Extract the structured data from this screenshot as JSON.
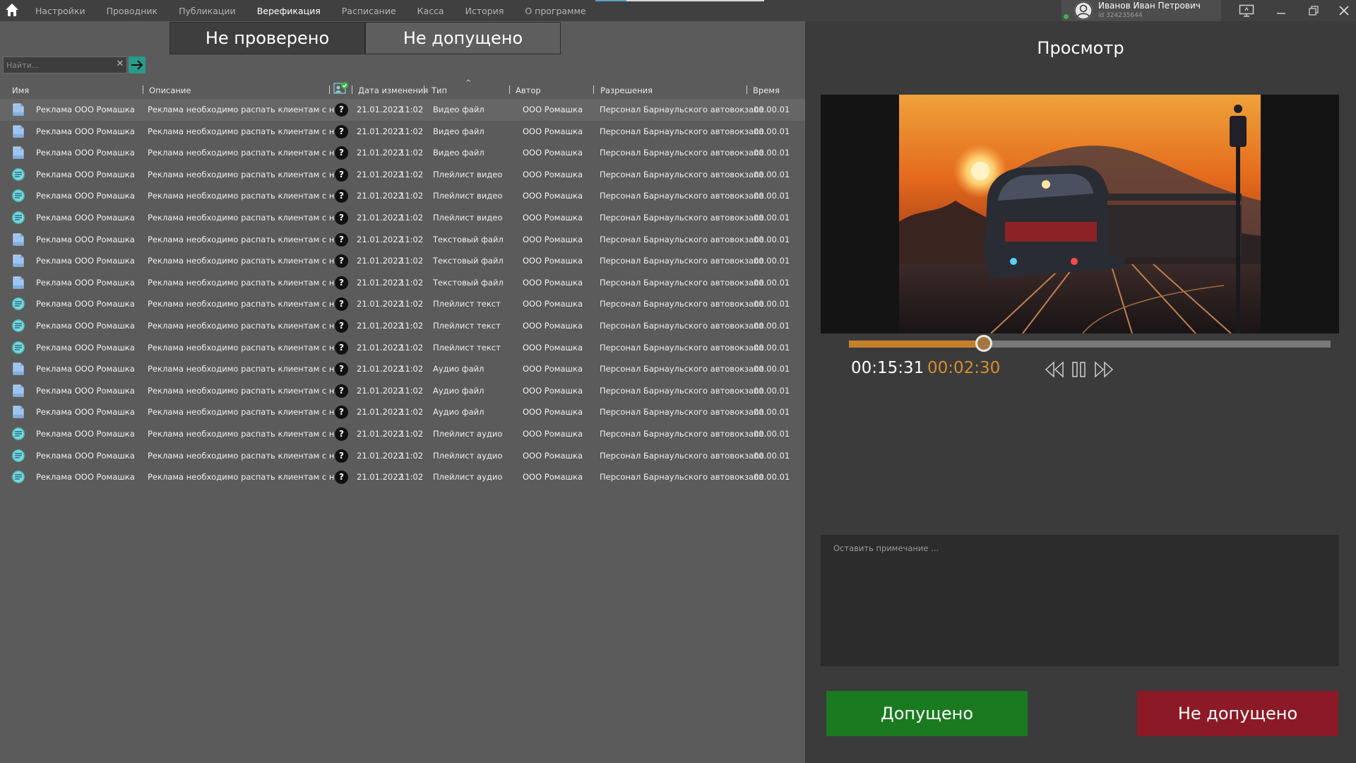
{
  "nav": {
    "items": [
      "Настройки",
      "Проводник",
      "Публикации",
      "Верефикация",
      "Расписание",
      "Касса",
      "История",
      "О программе"
    ],
    "active_index": 3
  },
  "user": {
    "name": "Иванов Иван Петрович",
    "id": "id 324235644",
    "status": "online"
  },
  "tabs": {
    "unverified": "Не проверено",
    "rejected": "Не допущено",
    "active": "unverified"
  },
  "search": {
    "placeholder": "Найти...",
    "clear_label": "✕"
  },
  "table": {
    "columns": {
      "name": "Имя",
      "description": "Описание",
      "date": "Дата изменения",
      "type": "Тип",
      "author": "Автор",
      "permissions": "Разрешения",
      "time": "Время"
    },
    "sort_indicator": "^",
    "rows": [
      {
        "icon": "file-icon",
        "name": "Реклама ООО Ромашка",
        "description": "Реклама необходимо распать клиентам с на...",
        "date": "21.01.2022",
        "time_of_day": "11:02",
        "type": "Видео файл",
        "author": "ООО Ромашка",
        "permissions": "Персонал Барнаульского автовокзала",
        "duration": "00.00.01"
      },
      {
        "icon": "file-icon",
        "name": "Реклама ООО Ромашка",
        "description": "Реклама необходимо распать клиентам с на...",
        "date": "21.01.2022",
        "time_of_day": "11:02",
        "type": "Видео файл",
        "author": "ООО Ромашка",
        "permissions": "Персонал Барнаульского автовокзала",
        "duration": "00.00.01"
      },
      {
        "icon": "file-icon",
        "name": "Реклама ООО Ромашка",
        "description": "Реклама необходимо распать клиентам с на...",
        "date": "21.01.2022",
        "time_of_day": "11:02",
        "type": "Видео файл",
        "author": "ООО Ромашка",
        "permissions": "Персонал Барнаульского автовокзала",
        "duration": "00.00.01"
      },
      {
        "icon": "playlist-icon",
        "name": "Реклама ООО Ромашка",
        "description": "Реклама необходимо распать клиентам с на...",
        "date": "21.01.2022",
        "time_of_day": "11:02",
        "type": "Плейлист видео",
        "author": "ООО Ромашка",
        "permissions": "Персонал Барнаульского автовокзала",
        "duration": "00.00.01"
      },
      {
        "icon": "playlist-icon",
        "name": "Реклама ООО Ромашка",
        "description": "Реклама необходимо распать клиентам с на...",
        "date": "21.01.2022",
        "time_of_day": "11:02",
        "type": "Плейлист видео",
        "author": "ООО Ромашка",
        "permissions": "Персонал Барнаульского автовокзала",
        "duration": "00.00.01"
      },
      {
        "icon": "playlist-icon",
        "name": "Реклама ООО Ромашка",
        "description": "Реклама необходимо распать клиентам с на...",
        "date": "21.01.2022",
        "time_of_day": "11:02",
        "type": "Плейлист видео",
        "author": "ООО Ромашка",
        "permissions": "Персонал Барнаульского автовокзала",
        "duration": "00.00.01"
      },
      {
        "icon": "file-icon",
        "name": "Реклама ООО Ромашка",
        "description": "Реклама необходимо распать клиентам с на...",
        "date": "21.01.2022",
        "time_of_day": "11:02",
        "type": "Текстовый файл",
        "author": "ООО Ромашка",
        "permissions": "Персонал Барнаульского автовокзала",
        "duration": "00.00.01"
      },
      {
        "icon": "file-icon",
        "name": "Реклама ООО Ромашка",
        "description": "Реклама необходимо распать клиентам с на...",
        "date": "21.01.2022",
        "time_of_day": "11:02",
        "type": "Текстовый файл",
        "author": "ООО Ромашка",
        "permissions": "Персонал Барнаульского автовокзала",
        "duration": "00.00.01"
      },
      {
        "icon": "file-icon",
        "name": "Реклама ООО Ромашка",
        "description": "Реклама необходимо распать клиентам с на...",
        "date": "21.01.2022",
        "time_of_day": "11:02",
        "type": "Текстовый файл",
        "author": "ООО Ромашка",
        "permissions": "Персонал Барнаульского автовокзала",
        "duration": "00.00.01"
      },
      {
        "icon": "playlist-icon",
        "name": "Реклама ООО Ромашка",
        "description": "Реклама необходимо распать клиентам с на...",
        "date": "21.01.2022",
        "time_of_day": "11:02",
        "type": "Плейлист текст",
        "author": "ООО Ромашка",
        "permissions": "Персонал Барнаульского автовокзала",
        "duration": "00.00.01"
      },
      {
        "icon": "playlist-icon",
        "name": "Реклама ООО Ромашка",
        "description": "Реклама необходимо распать клиентам с на...",
        "date": "21.01.2022",
        "time_of_day": "11:02",
        "type": "Плейлист текст",
        "author": "ООО Ромашка",
        "permissions": "Персонал Барнаульского автовокзала",
        "duration": "00.00.01"
      },
      {
        "icon": "playlist-icon",
        "name": "Реклама ООО Ромашка",
        "description": "Реклама необходимо распать клиентам с на...",
        "date": "21.01.2022",
        "time_of_day": "11:02",
        "type": "Плейлист текст",
        "author": "ООО Ромашка",
        "permissions": "Персонал Барнаульского автовокзала",
        "duration": "00.00.01"
      },
      {
        "icon": "file-icon",
        "name": "Реклама ООО Ромашка",
        "description": "Реклама необходимо распать клиентам с на...",
        "date": "21.01.2022",
        "time_of_day": "11:02",
        "type": "Аудио файл",
        "author": "ООО Ромашка",
        "permissions": "Персонал Барнаульского автовокзала",
        "duration": "00.00.01"
      },
      {
        "icon": "file-icon",
        "name": "Реклама ООО Ромашка",
        "description": "Реклама необходимо распать клиентам с на...",
        "date": "21.01.2022",
        "time_of_day": "11:02",
        "type": "Аудио файл",
        "author": "ООО Ромашка",
        "permissions": "Персонал Барнаульского автовокзала",
        "duration": "00.00.01"
      },
      {
        "icon": "file-icon",
        "name": "Реклама ООО Ромашка",
        "description": "Реклама необходимо распать клиентам с на...",
        "date": "21.01.2022",
        "time_of_day": "11:02",
        "type": "Аудио файл",
        "author": "ООО Ромашка",
        "permissions": "Персонал Барнаульского автовокзала",
        "duration": "00.00.01"
      },
      {
        "icon": "playlist-icon",
        "name": "Реклама ООО Ромашка",
        "description": "Реклама необходимо распать клиентам с на...",
        "date": "21.01.2022",
        "time_of_day": "11:02",
        "type": "Плейлист аудио",
        "author": "ООО Ромашка",
        "permissions": "Персонал Барнаульского автовокзала",
        "duration": "00.00.01"
      },
      {
        "icon": "playlist-icon",
        "name": "Реклама ООО Ромашка",
        "description": "Реклама необходимо распать клиентам с на...",
        "date": "21.01.2022",
        "time_of_day": "11:02",
        "type": "Плейлист аудио",
        "author": "ООО Ромашка",
        "permissions": "Персонал Барнаульского автовокзала",
        "duration": "00.00.01"
      },
      {
        "icon": "playlist-icon",
        "name": "Реклама ООО Ромашка",
        "description": "Реклама необходимо распать клиентам с на...",
        "date": "21.01.2022",
        "time_of_day": "11:02",
        "type": "Плейлист аудио",
        "author": "ООО Ромашка",
        "permissions": "Персонал Барнаульского автовокзала",
        "duration": "00.00.01"
      }
    ]
  },
  "preview": {
    "title": "Просмотр",
    "total_time": "00:15:31",
    "current_time": "00:02:30",
    "progress": 0.28,
    "note_placeholder": "Оставить примечание ...",
    "approve_label": "Допущено",
    "reject_label": "Не допущено"
  },
  "colors": {
    "accent_progress": "#c7802a",
    "current_time": "#d98c2a",
    "approve": "#1a7a1f",
    "reject": "#8c1a26",
    "search_go": "#2a9b8a",
    "status_online": "#3cb44a"
  }
}
